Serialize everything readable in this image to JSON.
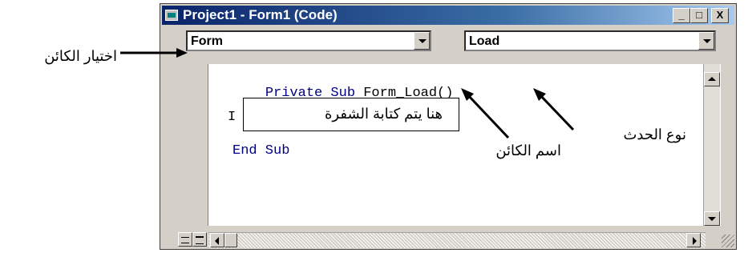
{
  "window": {
    "title": "Project1 - Form1 (Code)",
    "controls": {
      "minimize": "_",
      "maximize": "□",
      "close": "X"
    }
  },
  "object_combo": {
    "value": "Form"
  },
  "event_combo": {
    "value": "Load"
  },
  "code": {
    "line1_keyword": "Private Sub",
    "line1_name": "Form_Load()",
    "line2_cursor": "I",
    "line3": "End Sub"
  },
  "annotations": {
    "object_select": "اختيار الكائن",
    "code_here": "هنا يتم كتابة الشفرة",
    "object_name": "اسم الكائن",
    "event_type": "نوع الحدث"
  },
  "colors": {
    "keyword": "#000080",
    "title_start": "#0a246a",
    "title_end": "#a6caf0"
  }
}
